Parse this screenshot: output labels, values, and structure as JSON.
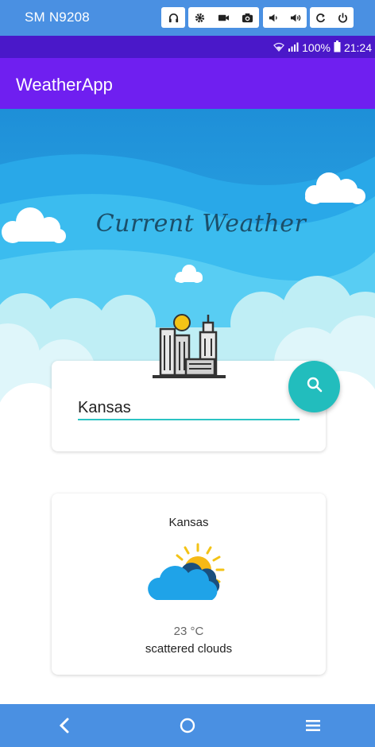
{
  "emulator": {
    "device_name": "SM N9208",
    "icons": [
      "headphones-icon",
      "settings-icon",
      "video-icon",
      "camera-icon",
      "volume-down-icon",
      "volume-up-icon",
      "rotate-icon",
      "power-icon"
    ]
  },
  "status_bar": {
    "battery": "100%",
    "time": "21:24",
    "icons": [
      "wifi-icon",
      "signal-icon",
      "battery-icon"
    ]
  },
  "app_bar": {
    "title": "WeatherApp"
  },
  "hero": {
    "title": "Current Weather"
  },
  "search": {
    "value": "Kansas",
    "button_icon": "search-icon"
  },
  "weather": {
    "city": "Kansas",
    "temperature": "23 °C",
    "description": "scattered clouds",
    "icon": "partly-cloudy-icon"
  },
  "nav": {
    "icons": [
      "back-icon",
      "home-icon",
      "menu-icon"
    ]
  },
  "colors": {
    "emulator_bar": "#4a90e2",
    "status_bar": "#4a18c9",
    "app_bar": "#6f1ff0",
    "accent": "#22bdbd",
    "sky": "#2aa7e6"
  }
}
